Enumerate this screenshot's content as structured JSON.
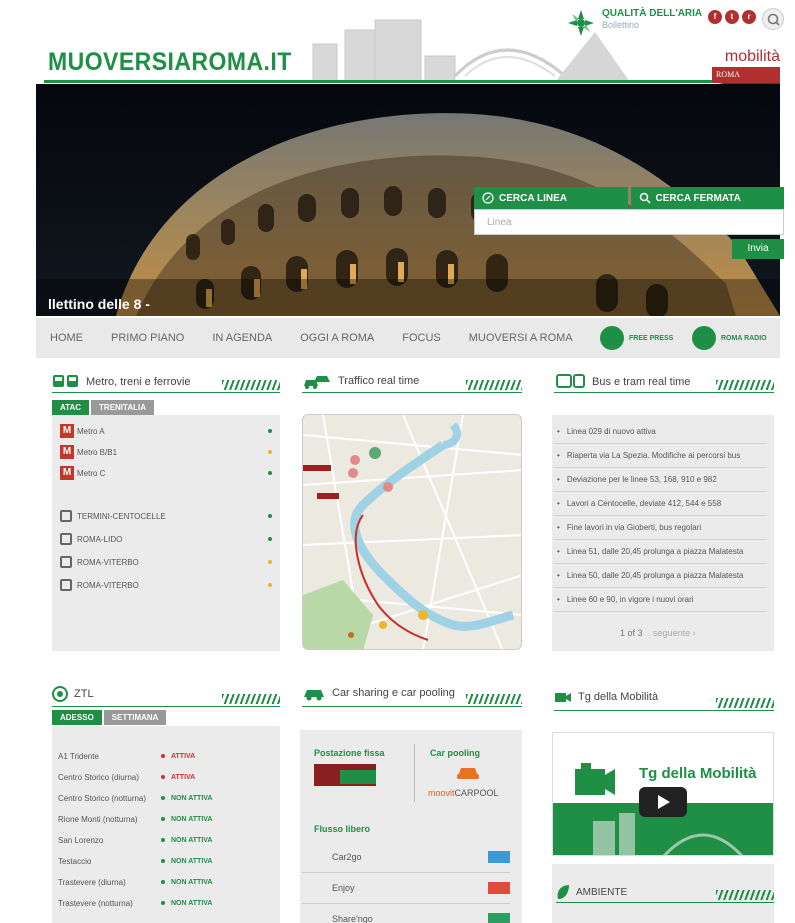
{
  "header": {
    "logo": "MUOVERSIAROMA.IT",
    "air_title": "QUALITÀ DELL'ARIA",
    "air_sub": "Bollettino",
    "mobilita_word": "mobilità",
    "mobilita_roma": "ROMA",
    "social_icons": [
      "facebook-icon",
      "twitter-icon",
      "rss-icon"
    ]
  },
  "hero": {
    "title": "llettino delle 8 -",
    "search": {
      "tab_line": "CERCA LINEA",
      "tab_stop": "CERCA FERMATA",
      "placeholder": "Linea",
      "submit": "Invia"
    }
  },
  "nav": {
    "items": [
      "HOME",
      "PRIMO PIANO",
      "IN AGENDA",
      "OGGI A ROMA",
      "FOCUS",
      "MUOVERSI A ROMA"
    ],
    "free_press": "FREE PRESS",
    "roma_radio": "ROMA RADIO"
  },
  "metro": {
    "title": "Metro, treni e ferrovie",
    "tabs": [
      "ATAC",
      "TRENITALIA"
    ],
    "lines": [
      {
        "label": "Metro A",
        "status": "green"
      },
      {
        "label": "Metro B/B1",
        "status": "yellow"
      },
      {
        "label": "Metro C",
        "status": "green"
      }
    ],
    "railways": [
      {
        "label": "TERMINI-CENTOCELLE",
        "status": "green"
      },
      {
        "label": "ROMA-LIDO",
        "status": "green"
      },
      {
        "label": "ROMA-VITERBO",
        "status": "yellow"
      },
      {
        "label": "ROMA-VITERBO",
        "status": "yellow"
      }
    ]
  },
  "traffic": {
    "title": "Traffico real time"
  },
  "bus": {
    "title": "Bus e tram real time",
    "items": [
      "Linea 029 di nuovo attiva",
      "Riaperta via La Spezia. Modifiche ai percorsi bus",
      "Deviazione per le linee 53, 168, 910 e 982",
      "Lavori a Centocelle, deviate 412, 544 e 558",
      "Fine lavori in via Gioberti, bus regolari",
      "Linea 51, dalle 20,45 prolunga a piazza Malatesta",
      "Linea 50, dalle 20,45 prolunga a piazza Malatesta",
      "Linee 60 e 90, in vigore i nuovi orari"
    ],
    "pager": "1 of 3",
    "next": "seguente ›"
  },
  "ztl": {
    "title": "ZTL",
    "tabs": [
      "ADESSO",
      "SETTIMANA"
    ],
    "rows": [
      {
        "name": "A1 Tridente",
        "status": "ATTIVA",
        "color": "#d03030"
      },
      {
        "name": "Centro Storico (diurna)",
        "status": "ATTIVA",
        "color": "#d03030"
      },
      {
        "name": "Centro Storico (notturna)",
        "status": "NON ATTIVA",
        "color": "#1e8f45"
      },
      {
        "name": "Rione Monti (notturna)",
        "status": "NON ATTIVA",
        "color": "#1e8f45"
      },
      {
        "name": "San Lorenzo",
        "status": "NON ATTIVA",
        "color": "#1e8f45"
      },
      {
        "name": "Testaccio",
        "status": "NON ATTIVA",
        "color": "#1e8f45"
      },
      {
        "name": "Trastevere (diurna)",
        "status": "NON ATTIVA",
        "color": "#1e8f45"
      },
      {
        "name": "Trastevere (notturna)",
        "status": "NON ATTIVA",
        "color": "#1e8f45"
      }
    ]
  },
  "carsharing": {
    "title": "Car sharing e car pooling",
    "fixed_label": "Postazione fissa",
    "pooling_label": "Car pooling",
    "moovit": "moovit",
    "carpool": "CARPOOL",
    "free_label": "Flusso libero",
    "services": [
      "Car2go",
      "Enjoy",
      "Share'ngo"
    ]
  },
  "tg": {
    "title": "Tg della Mobilità",
    "video_title": "Tg della Mobilità"
  },
  "ambiente": {
    "title": "AMBIENTE"
  },
  "colors": {
    "green": "#1e8f45",
    "red": "#c0392b",
    "yellow": "#f0b429"
  }
}
